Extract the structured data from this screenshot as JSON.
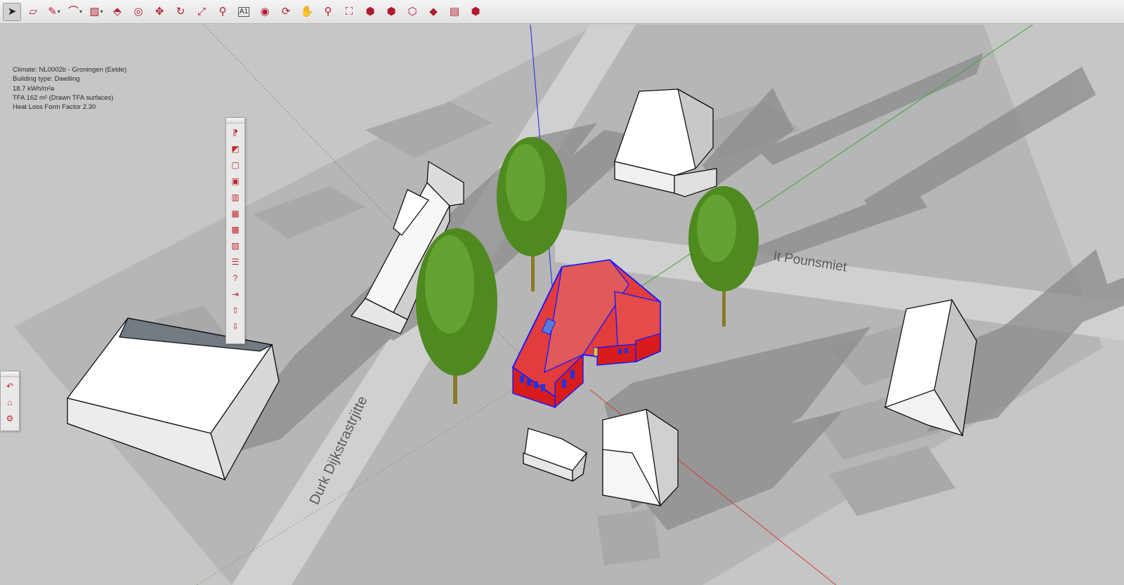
{
  "toolbar": {
    "tools": [
      {
        "name": "select-tool",
        "icon": "arrow-cursor-icon",
        "glyph": "➤",
        "active": true
      },
      {
        "name": "eraser-tool",
        "icon": "eraser-icon",
        "glyph": "▱"
      },
      {
        "name": "line-tool",
        "icon": "pencil-icon",
        "glyph": "✎",
        "dropdown": true
      },
      {
        "name": "arc-tool",
        "icon": "arc-icon",
        "glyph": "⌒",
        "dropdown": true
      },
      {
        "name": "rectangle-tool",
        "icon": "rectangle-icon",
        "glyph": "▧",
        "dropdown": true
      },
      {
        "name": "push-pull-tool",
        "icon": "push-pull-icon",
        "glyph": "⬘"
      },
      {
        "name": "offset-tool",
        "icon": "offset-icon",
        "glyph": "◎"
      },
      {
        "name": "move-tool",
        "icon": "move-icon",
        "glyph": "✥"
      },
      {
        "name": "rotate-tool",
        "icon": "rotate-icon",
        "glyph": "↻"
      },
      {
        "name": "scale-tool",
        "icon": "scale-icon",
        "glyph": "⤢"
      },
      {
        "name": "tape-measure-tool",
        "icon": "tape-measure-icon",
        "glyph": "⚲"
      },
      {
        "name": "text-tool",
        "icon": "text-icon",
        "glyph": "A1"
      },
      {
        "name": "paint-bucket-tool",
        "icon": "paint-bucket-icon",
        "glyph": "◉"
      },
      {
        "name": "orbit-tool",
        "icon": "orbit-icon",
        "glyph": "⟳"
      },
      {
        "name": "pan-tool",
        "icon": "hand-icon",
        "glyph": "✋"
      },
      {
        "name": "zoom-tool",
        "icon": "zoom-icon",
        "glyph": "⚲"
      },
      {
        "name": "zoom-extents-tool",
        "icon": "zoom-extents-icon",
        "glyph": "⛶"
      },
      {
        "name": "3d-warehouse-tool",
        "icon": "warehouse-icon",
        "glyph": "⬢"
      },
      {
        "name": "share-model-tool",
        "icon": "share-model-icon",
        "glyph": "⬢"
      },
      {
        "name": "share-component-tool",
        "icon": "share-component-icon",
        "glyph": "⬡"
      },
      {
        "name": "extension-warehouse-tool",
        "icon": "extension-warehouse-icon",
        "glyph": "◆"
      },
      {
        "name": "layout-tool",
        "icon": "layout-icon",
        "glyph": "▤"
      },
      {
        "name": "extension-manager-tool",
        "icon": "extension-manager-icon",
        "glyph": "⬢"
      }
    ]
  },
  "info_lines": [
    "Climate: NL0002b - Groningen (Eelde)",
    "Building type: Dwelling",
    "18.7 kWh/m²a",
    "TFA  162 m² (Drawn TFA surfaces)",
    "Heat Loss Form Factor 2.30"
  ],
  "streets": {
    "street_1": "It Pounsmiet",
    "street_2": "Durk Dijkstrastrjitte"
  },
  "extension_toolbar": [
    {
      "name": "designph-logo-button",
      "icon": "designph-logo-icon",
      "glyph": "⁋"
    },
    {
      "name": "select-surface-button",
      "icon": "select-surface-icon",
      "glyph": "◩"
    },
    {
      "name": "window-button",
      "icon": "window-icon",
      "glyph": "▢"
    },
    {
      "name": "glazing-button",
      "icon": "glazing-icon",
      "glyph": "▣"
    },
    {
      "name": "chart-button",
      "icon": "bar-chart-icon",
      "glyph": "▥"
    },
    {
      "name": "heating-button",
      "icon": "heating-block-icon",
      "glyph": "▦"
    },
    {
      "name": "volume-button",
      "icon": "volume-block-icon",
      "glyph": "▩"
    },
    {
      "name": "shading-button",
      "icon": "shading-block-icon",
      "glyph": "▨"
    },
    {
      "name": "layers-button",
      "icon": "layers-icon",
      "glyph": "☰"
    },
    {
      "name": "help-button",
      "icon": "help-icon",
      "glyph": "?"
    },
    {
      "name": "export-button",
      "icon": "export-icon",
      "glyph": "⇥"
    },
    {
      "name": "upload-button",
      "icon": "upload-icon",
      "glyph": "⇧"
    },
    {
      "name": "download-button",
      "icon": "download-icon",
      "glyph": "⇩"
    }
  ],
  "side_toolbar": [
    {
      "name": "undo-view-button",
      "icon": "undo-view-icon",
      "glyph": "↶"
    },
    {
      "name": "building-button",
      "icon": "building-icon",
      "glyph": "⌂"
    },
    {
      "name": "settings-button",
      "icon": "settings-icon",
      "glyph": "⚙"
    }
  ],
  "colors": {
    "ground": "#bdbdbd",
    "plot": "#aeaeae",
    "shadow": "#8d8d8d",
    "road": "#d3d3d3",
    "roof_red": "#e64b4b",
    "wall_red": "#e02020",
    "window_blue": "#2232e0",
    "outline_blue": "#1a1aff",
    "tree_green": "#4f8a21",
    "axis_red": "#d83a3a",
    "axis_green": "#3aa83a",
    "axis_blue": "#3a3ad8"
  }
}
